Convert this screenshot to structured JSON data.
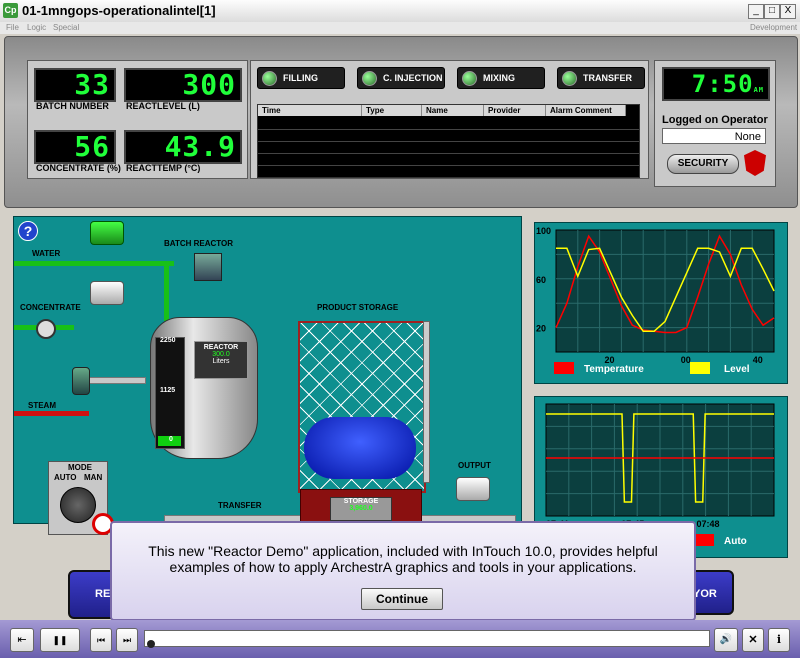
{
  "window": {
    "title": "01-1mngops-operationalintel[1]",
    "icon": "Cp",
    "btn_min": "_",
    "btn_max": "□",
    "btn_close": "X"
  },
  "menu": {
    "file": "File",
    "logic": "Logic",
    "special": "Special",
    "right": "Development"
  },
  "metrics": {
    "batch_number": {
      "value": "33",
      "label": "BATCH NUMBER"
    },
    "react_level": {
      "value": "300",
      "label": "REACTLEVEL (L)"
    },
    "concentrate": {
      "value": "56",
      "label": "CONCENTRATE (%)"
    },
    "react_temp": {
      "value": "43.9",
      "label": "REACTTEMP  (°C)"
    }
  },
  "status": {
    "filling": "FILLING",
    "c_injection": "C. INJECTION",
    "mixing": "MIXING",
    "transfer": "TRANSFER"
  },
  "alarms": {
    "columns": [
      "Time",
      "Type",
      "Name",
      "Provider",
      "Alarm Comment"
    ]
  },
  "clock": {
    "time": "7:50",
    "ampm": "AM"
  },
  "operator": {
    "heading": "Logged on Operator",
    "name": "None",
    "security_label": "SECURITY"
  },
  "process": {
    "help": "?",
    "water": "WATER",
    "concentrate": "CONCENTRATE",
    "steam": "STEAM",
    "batch_reactor": "BATCH REACTOR",
    "reactor": "REACTOR",
    "reactor_value": "300.0",
    "reactor_unit": "Liters",
    "scale_top": "2250",
    "scale_mid": "1125",
    "scale_bottom": "0",
    "product_storage": "PRODUCT STORAGE",
    "storage": "STORAGE",
    "storage_value": "3,960.0",
    "output": "OUTPUT",
    "transfer": "TRANSFER",
    "mode": "MODE",
    "auto": "AUTO",
    "man": "MAN"
  },
  "chart_data": [
    {
      "type": "line",
      "ylim": [
        0,
        100
      ],
      "yticks": [
        "100",
        "60",
        "20"
      ],
      "xticks": [
        "20",
        "00",
        "40"
      ],
      "series": [
        {
          "name": "Temperature",
          "color": "#ff0000",
          "x": [
            0,
            1,
            2,
            3,
            4,
            5,
            6,
            7,
            8,
            9,
            10,
            11,
            12,
            13,
            14,
            15,
            16,
            17,
            18,
            19,
            20
          ],
          "values": [
            20,
            40,
            70,
            95,
            82,
            60,
            38,
            22,
            18,
            17,
            16,
            16,
            20,
            45,
            72,
            95,
            80,
            55,
            35,
            22,
            28
          ]
        },
        {
          "name": "Level",
          "color": "#ffff00",
          "x": [
            0,
            1,
            2,
            3,
            4,
            5,
            6,
            7,
            8,
            9,
            10,
            11,
            12,
            13,
            14,
            15,
            16,
            17,
            18,
            19,
            20
          ],
          "values": [
            85,
            85,
            62,
            84,
            85,
            65,
            45,
            30,
            17,
            17,
            25,
            45,
            65,
            85,
            85,
            82,
            62,
            85,
            85,
            68,
            50
          ]
        }
      ]
    },
    {
      "type": "line",
      "xticks": [
        "07:41",
        "07:45",
        "07:48"
      ],
      "ylim": [
        0,
        1
      ],
      "series": [
        {
          "name": "Auto",
          "color": "#ffff00",
          "x": [
            0,
            16,
            16.5,
            18,
            18.5,
            31,
            31.5,
            33,
            33.5,
            48
          ],
          "values": [
            1,
            1,
            0,
            0,
            1,
            1,
            0,
            0,
            1,
            1
          ]
        },
        {
          "name": "",
          "color": "#ff0000",
          "x": [
            0,
            48
          ],
          "values": [
            0.5,
            0.5
          ]
        }
      ]
    }
  ],
  "dialog": {
    "line1": "This new \"Reactor Demo\" application, included with InTouch 10.0, provides helpful",
    "line2": "examples of how to apply ArchestrA graphics and tools in your applications.",
    "continue": "Continue"
  },
  "bottom_buttons": {
    "left": "RE",
    "right": "YOR"
  },
  "player": {
    "exit": "⇤",
    "pause": "❚❚",
    "prev": "⏮",
    "next": "⏭",
    "audio": "🔊",
    "close": "✕",
    "info": "i"
  }
}
